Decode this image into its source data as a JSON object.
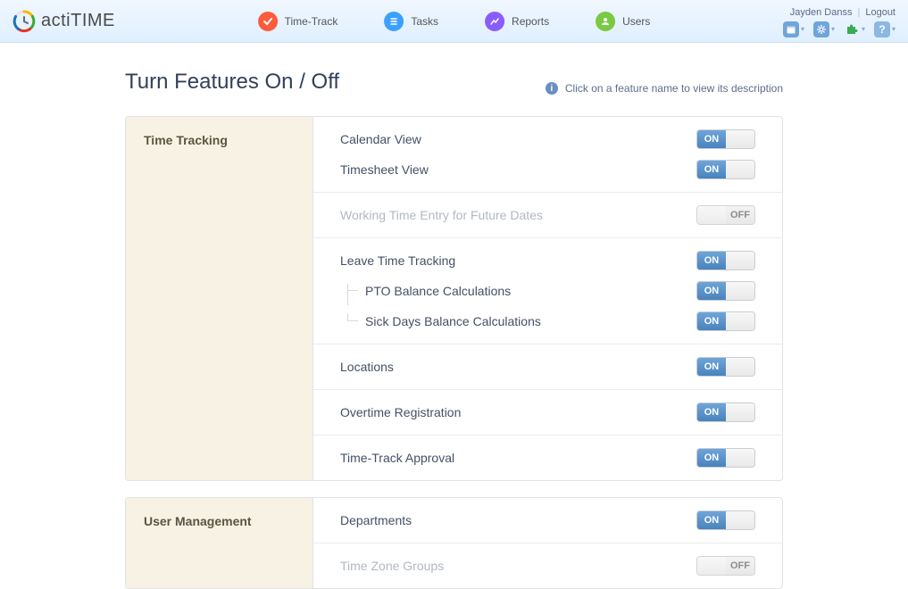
{
  "app": {
    "name": "actiTIME"
  },
  "nav": {
    "items": [
      {
        "label": "Time-Track",
        "color": "#ff5a3c"
      },
      {
        "label": "Tasks",
        "color": "#3ca0ff"
      },
      {
        "label": "Reports",
        "color": "#8a5cff"
      },
      {
        "label": "Users",
        "color": "#7ac943"
      }
    ]
  },
  "user": {
    "name": "Jayden Danss",
    "logout": "Logout"
  },
  "page": {
    "title": "Turn Features On / Off",
    "hint": "Click on a feature name to view its description"
  },
  "toggle": {
    "on": "ON",
    "off": "OFF"
  },
  "sections": {
    "time_tracking": {
      "title": "Time Tracking",
      "calendar_view": "Calendar View",
      "timesheet_view": "Timesheet View",
      "future_dates": "Working Time Entry for Future Dates",
      "leave_tracking": "Leave Time Tracking",
      "pto_balance": "PTO Balance Calculations",
      "sick_balance": "Sick Days Balance Calculations",
      "locations": "Locations",
      "overtime": "Overtime Registration",
      "approval": "Time-Track Approval"
    },
    "user_management": {
      "title": "User Management",
      "departments": "Departments",
      "tz_groups": "Time Zone Groups"
    }
  },
  "feature_states": {
    "calendar_view": true,
    "timesheet_view": true,
    "future_dates": false,
    "leave_tracking": true,
    "pto_balance": true,
    "sick_balance": true,
    "locations": true,
    "overtime": true,
    "approval": true,
    "departments": true,
    "tz_groups": false
  }
}
